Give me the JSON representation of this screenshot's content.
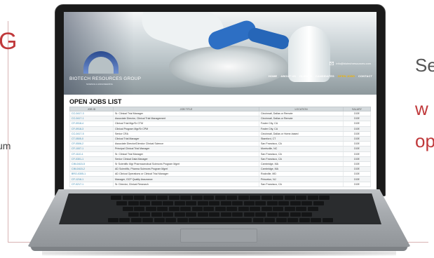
{
  "side_text": {
    "left_top": "G",
    "left_bottom": "um",
    "right_top": "Se",
    "right_mid": "w",
    "right_bottom": "op"
  },
  "site": {
    "logo_name": "BIOTECH RESOURCES GROUP",
    "logo_tagline": "SCIENCE & ENGINEERING",
    "topbar_text": "info@biotechresources.com",
    "nav": [
      "HOME",
      "ABOUT US",
      "CLIENTS",
      "CANDIDATES",
      "OPEN JOBS",
      "CONTACT"
    ],
    "active_nav": "OPEN JOBS",
    "jobs_title": "OPEN JOBS LIST"
  },
  "table": {
    "headers": [
      "JOB ID",
      "JOB TITLE",
      "LOCATION",
      "SALARY"
    ],
    "rows": [
      [
        "CC-0417-3",
        "Sr. Clinical Trial Manager",
        "Cincinnati, Dallas or Remote",
        "DOE"
      ],
      [
        "CC-0417-1",
        "Associate Director, Clinical Trial Management",
        "Cincinnati, Dallas or Remote",
        "DOE"
      ],
      [
        "CF-0918-4",
        "Clinical Trial Mgr/Sr CTM",
        "Foster City, CA",
        "DOE"
      ],
      [
        "CF-0918-3",
        "Clinical Program Mgr/Sr CPM",
        "Foster City, CA",
        "DOE"
      ],
      [
        "CC-0417-5",
        "Senior CRA",
        "Cincinnati, Dallas or Home-based",
        "DOE"
      ],
      [
        "CT-0505-0",
        "Clinical Trial Manager",
        "Stamford, CT",
        "DOE"
      ],
      [
        "CF-0506-2",
        "Associate Director/Director Clinical Science",
        "San Francisco, CA",
        "DOE"
      ],
      [
        "CF-1007-1",
        "Principal Clinical Trial Manager",
        "Morrisville, NC",
        "DOE"
      ],
      [
        "CF-1110-1",
        "Sr. Clinical Trial Manager",
        "San Francisco, CA",
        "DOE"
      ],
      [
        "CF-0301-1",
        "Senior Clinical Data Manager",
        "San Francisco, CA",
        "DOE"
      ],
      [
        "CIM-0415-5",
        "Sr Scientific Mgr Pharmaceutical Sciences Program Mgmt",
        "Cambridge, MA",
        "DOE"
      ],
      [
        "CIM-0415-2",
        "AD Scientific, Pharma Sciences Program Mgmt",
        "Cambridge, MA",
        "DOE"
      ],
      [
        "BRO-0305-1",
        "AD Clinical Operations or Clinical Trial Manager",
        "Rockville, MD",
        "DOE"
      ],
      [
        "CF-1216-1",
        "Manager, GCP Quality Assurance",
        "Princeton, NJ",
        "DOE"
      ],
      [
        "CF-0217-1",
        "Sr. Director, Clinical Research",
        "San Francisco, CA",
        "DOE"
      ]
    ]
  },
  "colors": {
    "accent_red": "#c0393b",
    "link_blue": "#3a88b0",
    "active_nav": "#f0b400"
  }
}
